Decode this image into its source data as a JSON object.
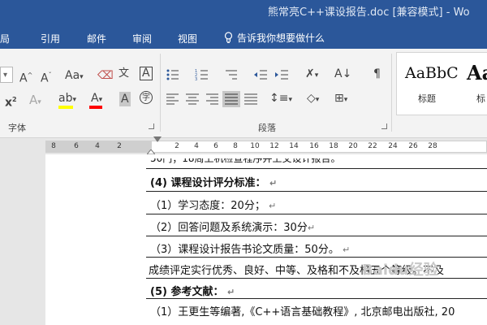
{
  "window": {
    "title": "熊常亮C++课设报告.doc [兼容模式] - Wo"
  },
  "menu": {
    "tabs": [
      "局",
      "引用",
      "邮件",
      "审阅",
      "视图"
    ],
    "tell_me": "告诉我你想要做什么"
  },
  "ribbon": {
    "font_group_label": "字体",
    "paragraph_group_label": "段落",
    "styles": [
      {
        "sample": "AaBbC",
        "label": "标题"
      },
      {
        "sample": "Aa",
        "label": "标"
      }
    ],
    "accent_colors": {
      "highlight": "#ffff00",
      "font_color": "#ff0000"
    }
  },
  "ruler": {
    "ticks": [
      "8",
      "6",
      "4",
      "2",
      "2",
      "4",
      "6",
      "8",
      "10",
      "12",
      "14",
      "16",
      "18",
      "20",
      "22",
      "24",
      "26",
      "28"
    ]
  },
  "document": {
    "partial_top": "50门；18周上机检查程序并上交设计报告。",
    "lines": [
      {
        "text": "(4) 课程设计评分标准：",
        "bold": true,
        "mark": "↵"
      },
      {
        "text": "（1）学习态度：20分；",
        "bold": false,
        "mark": "↵"
      },
      {
        "text": "（2）回答问题及系统演示：30分",
        "bold": false,
        "mark": "↵"
      },
      {
        "text": "（3）课程设计报告书论文质量：50分。",
        "bold": false,
        "mark": "↵"
      },
      {
        "text": "成绩评定实行优秀、良好、中等、及格和不及格五个等级。不及",
        "bold": false,
        "mark": ""
      },
      {
        "text": "(5) 参考文献：",
        "bold": true,
        "mark": "↵"
      },
      {
        "text": "（1）王更生等编著,《C++语言基础教程》, 北京邮电出版社, 20",
        "bold": false,
        "mark": ""
      }
    ],
    "watermark": "Baidu经验"
  }
}
